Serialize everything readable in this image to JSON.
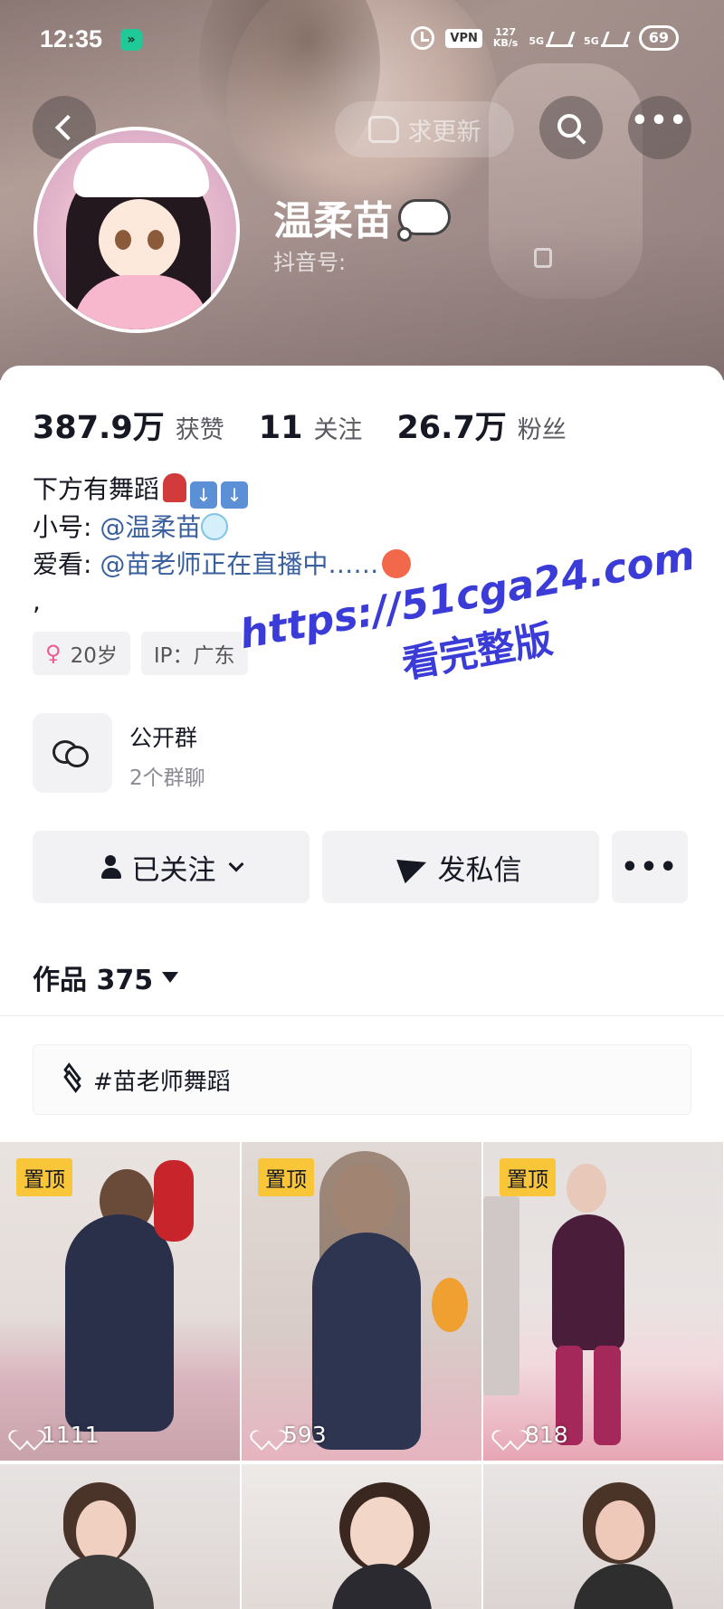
{
  "status_bar": {
    "time": "12:35",
    "vpn": "VPN",
    "speed_value": "127",
    "speed_unit": "KB/s",
    "signal_1": "5G",
    "signal_2": "5G",
    "battery": "69"
  },
  "header": {
    "update_label": "求更新",
    "icons": {
      "back": "chevron-left-icon",
      "search": "search-icon",
      "more": "more-dots-icon"
    }
  },
  "profile": {
    "name": "温柔苗",
    "douyin_id_label": "抖音号:"
  },
  "stats": [
    {
      "value": "387.9万",
      "label": "获赞"
    },
    {
      "value": "11",
      "label": "关注"
    },
    {
      "value": "26.7万",
      "label": "粉丝"
    }
  ],
  "bio": {
    "line1": "下方有舞蹈",
    "line2_prefix": "小号: ",
    "line2_mention": "@温柔苗",
    "line3_prefix": "爱看: ",
    "line3_mention": "@苗老师正在直播中……",
    "line4": ","
  },
  "tags": {
    "age": "20岁",
    "ip": "IP：广东"
  },
  "group": {
    "title": "公开群",
    "subtitle": "2个群聊"
  },
  "actions": {
    "follow": "已关注",
    "message": "发私信",
    "more": "•••"
  },
  "works": {
    "tab_label": "作品 375"
  },
  "collection": {
    "label": "#苗老师舞蹈"
  },
  "videos": [
    {
      "pinned": "置顶",
      "likes": "1111"
    },
    {
      "pinned": "置顶",
      "likes": "593"
    },
    {
      "pinned": "置顶",
      "likes": "818"
    },
    {
      "pinned": "",
      "likes": ""
    },
    {
      "pinned": "",
      "likes": ""
    },
    {
      "pinned": "",
      "likes": ""
    }
  ],
  "watermark": {
    "line1": "https://51cga24.com",
    "line2": "看完整版"
  },
  "colors": {
    "accent_link": "#3a5f9e",
    "pin_badge": "#f9c63a",
    "watermark": "#3b3bd8"
  }
}
